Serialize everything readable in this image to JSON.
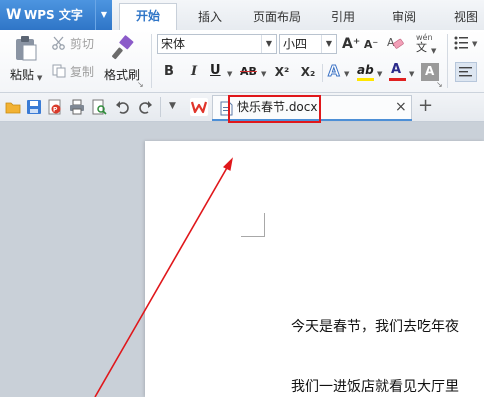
{
  "app": {
    "logo": "W",
    "title": "WPS 文字",
    "menu_arrow": "▼"
  },
  "menu_tabs": [
    {
      "label": "开始",
      "active": true
    },
    {
      "label": "插入",
      "active": false
    },
    {
      "label": "页面布局",
      "active": false
    },
    {
      "label": "引用",
      "active": false
    },
    {
      "label": "审阅",
      "active": false
    },
    {
      "label": "视图",
      "active": false
    }
  ],
  "clipboard": {
    "paste_label": "粘贴",
    "cut_label": "剪切",
    "copy_label": "复制",
    "format_painter_label": "格式刷"
  },
  "font": {
    "family": "宋体",
    "size": "小四",
    "pinyin_top": "wén",
    "pinyin_bottom": "文"
  },
  "format_buttons": {
    "bold": "B",
    "italic": "I",
    "underline": "U",
    "strikethrough": "AB",
    "superscript": "X²",
    "subscript": "X₂",
    "text_effect": "A",
    "highlight": "ab",
    "font_color": "A",
    "char_shading": "A",
    "grow": "A⁺",
    "shrink": "A⁻"
  },
  "colors": {
    "accent": "#2f75c7",
    "highlight_yellow": "#ffe600",
    "font_color_red": "#e02020",
    "annotation_red": "#e0171b"
  },
  "document_tab": {
    "title": "快乐春节.docx",
    "close": "×",
    "new_tab": "+"
  },
  "document": {
    "paragraphs": [
      "今天是春节，我们去吃年夜",
      "我们一进饭店就看见大厅里"
    ]
  }
}
